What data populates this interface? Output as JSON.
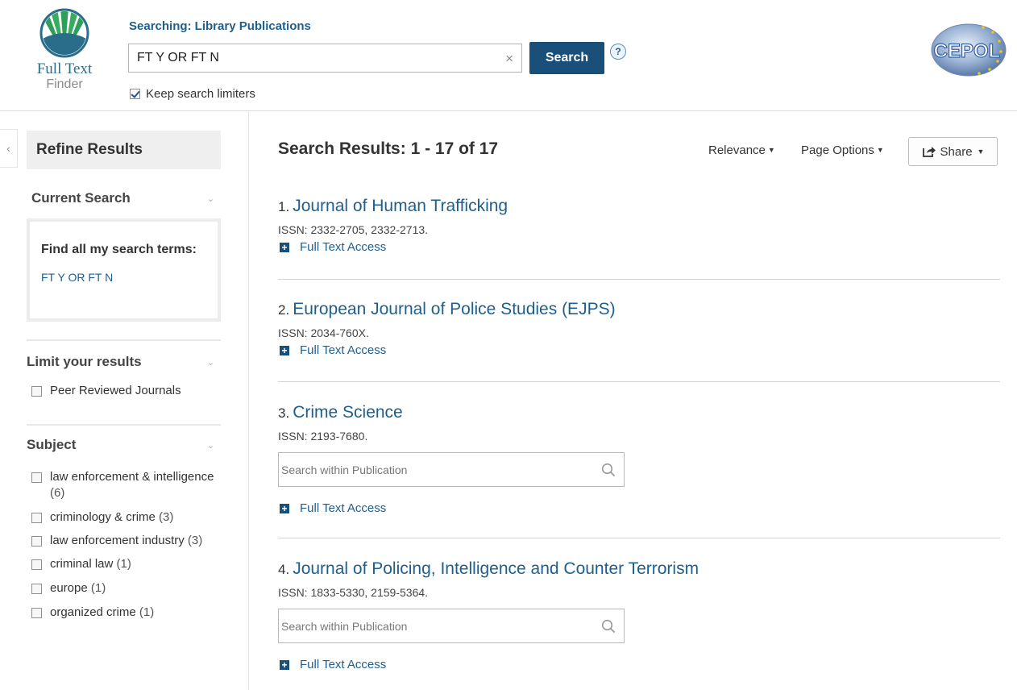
{
  "header": {
    "logo_line1": "Full Text",
    "logo_line2": "Finder",
    "searching_label": "Searching: Library Publications",
    "search_value": "FT Y OR FT N",
    "clear_symbol": "×",
    "search_button": "Search",
    "help_symbol": "?",
    "keep_limiters_label": "Keep search limiters",
    "keep_limiters_checked": true,
    "partner_logo_text": "CEPOL"
  },
  "sidebar": {
    "collapse_symbol": "‹",
    "refine_title": "Refine Results",
    "current_search": {
      "title": "Current Search",
      "find_all_label": "Find all my search terms:",
      "term": "FT Y OR FT N"
    },
    "limit": {
      "title": "Limit your results",
      "items": [
        {
          "label": "Peer Reviewed Journals",
          "checked": false
        }
      ]
    },
    "subject": {
      "title": "Subject",
      "items": [
        {
          "label": "law enforcement & intelligence",
          "count": "(6)"
        },
        {
          "label": "criminology & crime",
          "count": "(3)"
        },
        {
          "label": "law enforcement industry",
          "count": "(3)"
        },
        {
          "label": "criminal law",
          "count": "(1)"
        },
        {
          "label": "europe",
          "count": "(1)"
        },
        {
          "label": "organized crime",
          "count": "(1)"
        }
      ]
    }
  },
  "main": {
    "results_title": "Search Results: 1 - 17 of 17",
    "sort_label": "Relevance",
    "page_options_label": "Page Options",
    "share_label": "Share",
    "results": [
      {
        "num": "1.",
        "title": "Journal of Human Trafficking",
        "issn": "ISSN: 2332-2705, 2332-2713.",
        "access": "Full Text Access",
        "has_search": false
      },
      {
        "num": "2.",
        "title": "European Journal of Police Studies (EJPS)",
        "issn": "ISSN: 2034-760X.",
        "access": "Full Text Access",
        "has_search": false
      },
      {
        "num": "3.",
        "title": "Crime Science",
        "issn": "ISSN: 2193-7680.",
        "access": "Full Text Access",
        "has_search": true,
        "search_placeholder": "Search within Publication"
      },
      {
        "num": "4.",
        "title": "Journal of Policing, Intelligence and Counter Terrorism",
        "issn": "ISSN: 1833-5330, 2159-5364.",
        "access": "Full Text Access",
        "has_search": true,
        "search_placeholder": "Search within Publication"
      }
    ]
  },
  "colors": {
    "primary_button": "#1a4f7a",
    "link": "#1e5f8e",
    "logo_green": "#2e9e5a",
    "cepol_blue": "#2f5fa8"
  }
}
